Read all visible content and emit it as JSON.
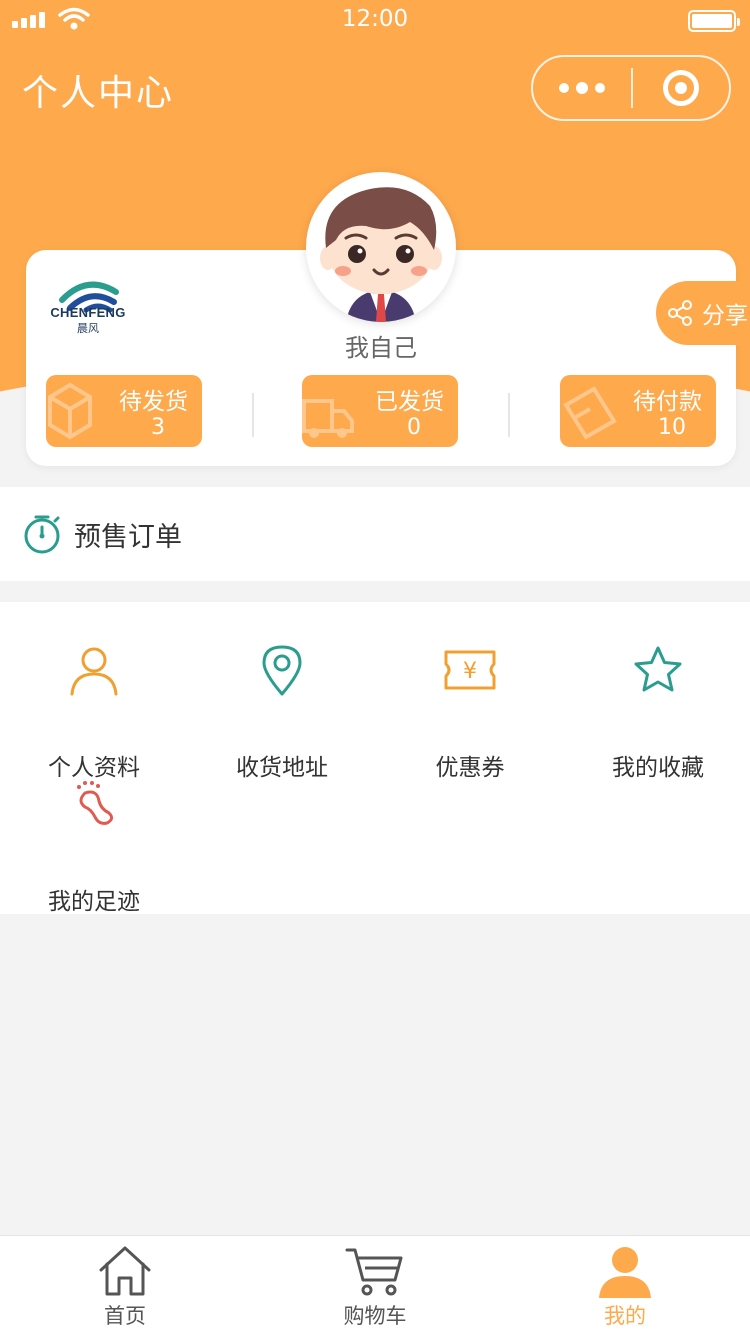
{
  "status_bar": {
    "time": "12:00"
  },
  "header": {
    "title": "个人中心"
  },
  "brand": {
    "name": "CHENFENG",
    "name_cn": "晨风"
  },
  "profile": {
    "name": "我自己"
  },
  "share": {
    "label": "分享"
  },
  "order_stats": [
    {
      "label": "待发货",
      "count": "3"
    },
    {
      "label": "已发货",
      "count": "0"
    },
    {
      "label": "待付款",
      "count": "10"
    }
  ],
  "presale": {
    "label": "预售订单"
  },
  "menu": [
    {
      "label": "个人资料",
      "icon": "user-icon"
    },
    {
      "label": "收货地址",
      "icon": "location-pin-icon"
    },
    {
      "label": "优惠券",
      "icon": "coupon-icon"
    },
    {
      "label": "我的收藏",
      "icon": "star-icon"
    },
    {
      "label": "我的足迹",
      "icon": "footprint-icon"
    }
  ],
  "tabbar": [
    {
      "label": "首页",
      "icon": "home-icon",
      "active": false
    },
    {
      "label": "购物车",
      "icon": "cart-icon",
      "active": false
    },
    {
      "label": "我的",
      "icon": "person-icon",
      "active": true
    }
  ],
  "colors": {
    "primary": "#ffa94d",
    "teal": "#2a9d8f",
    "red": "#e05a4f",
    "background": "#f3f3f3"
  }
}
